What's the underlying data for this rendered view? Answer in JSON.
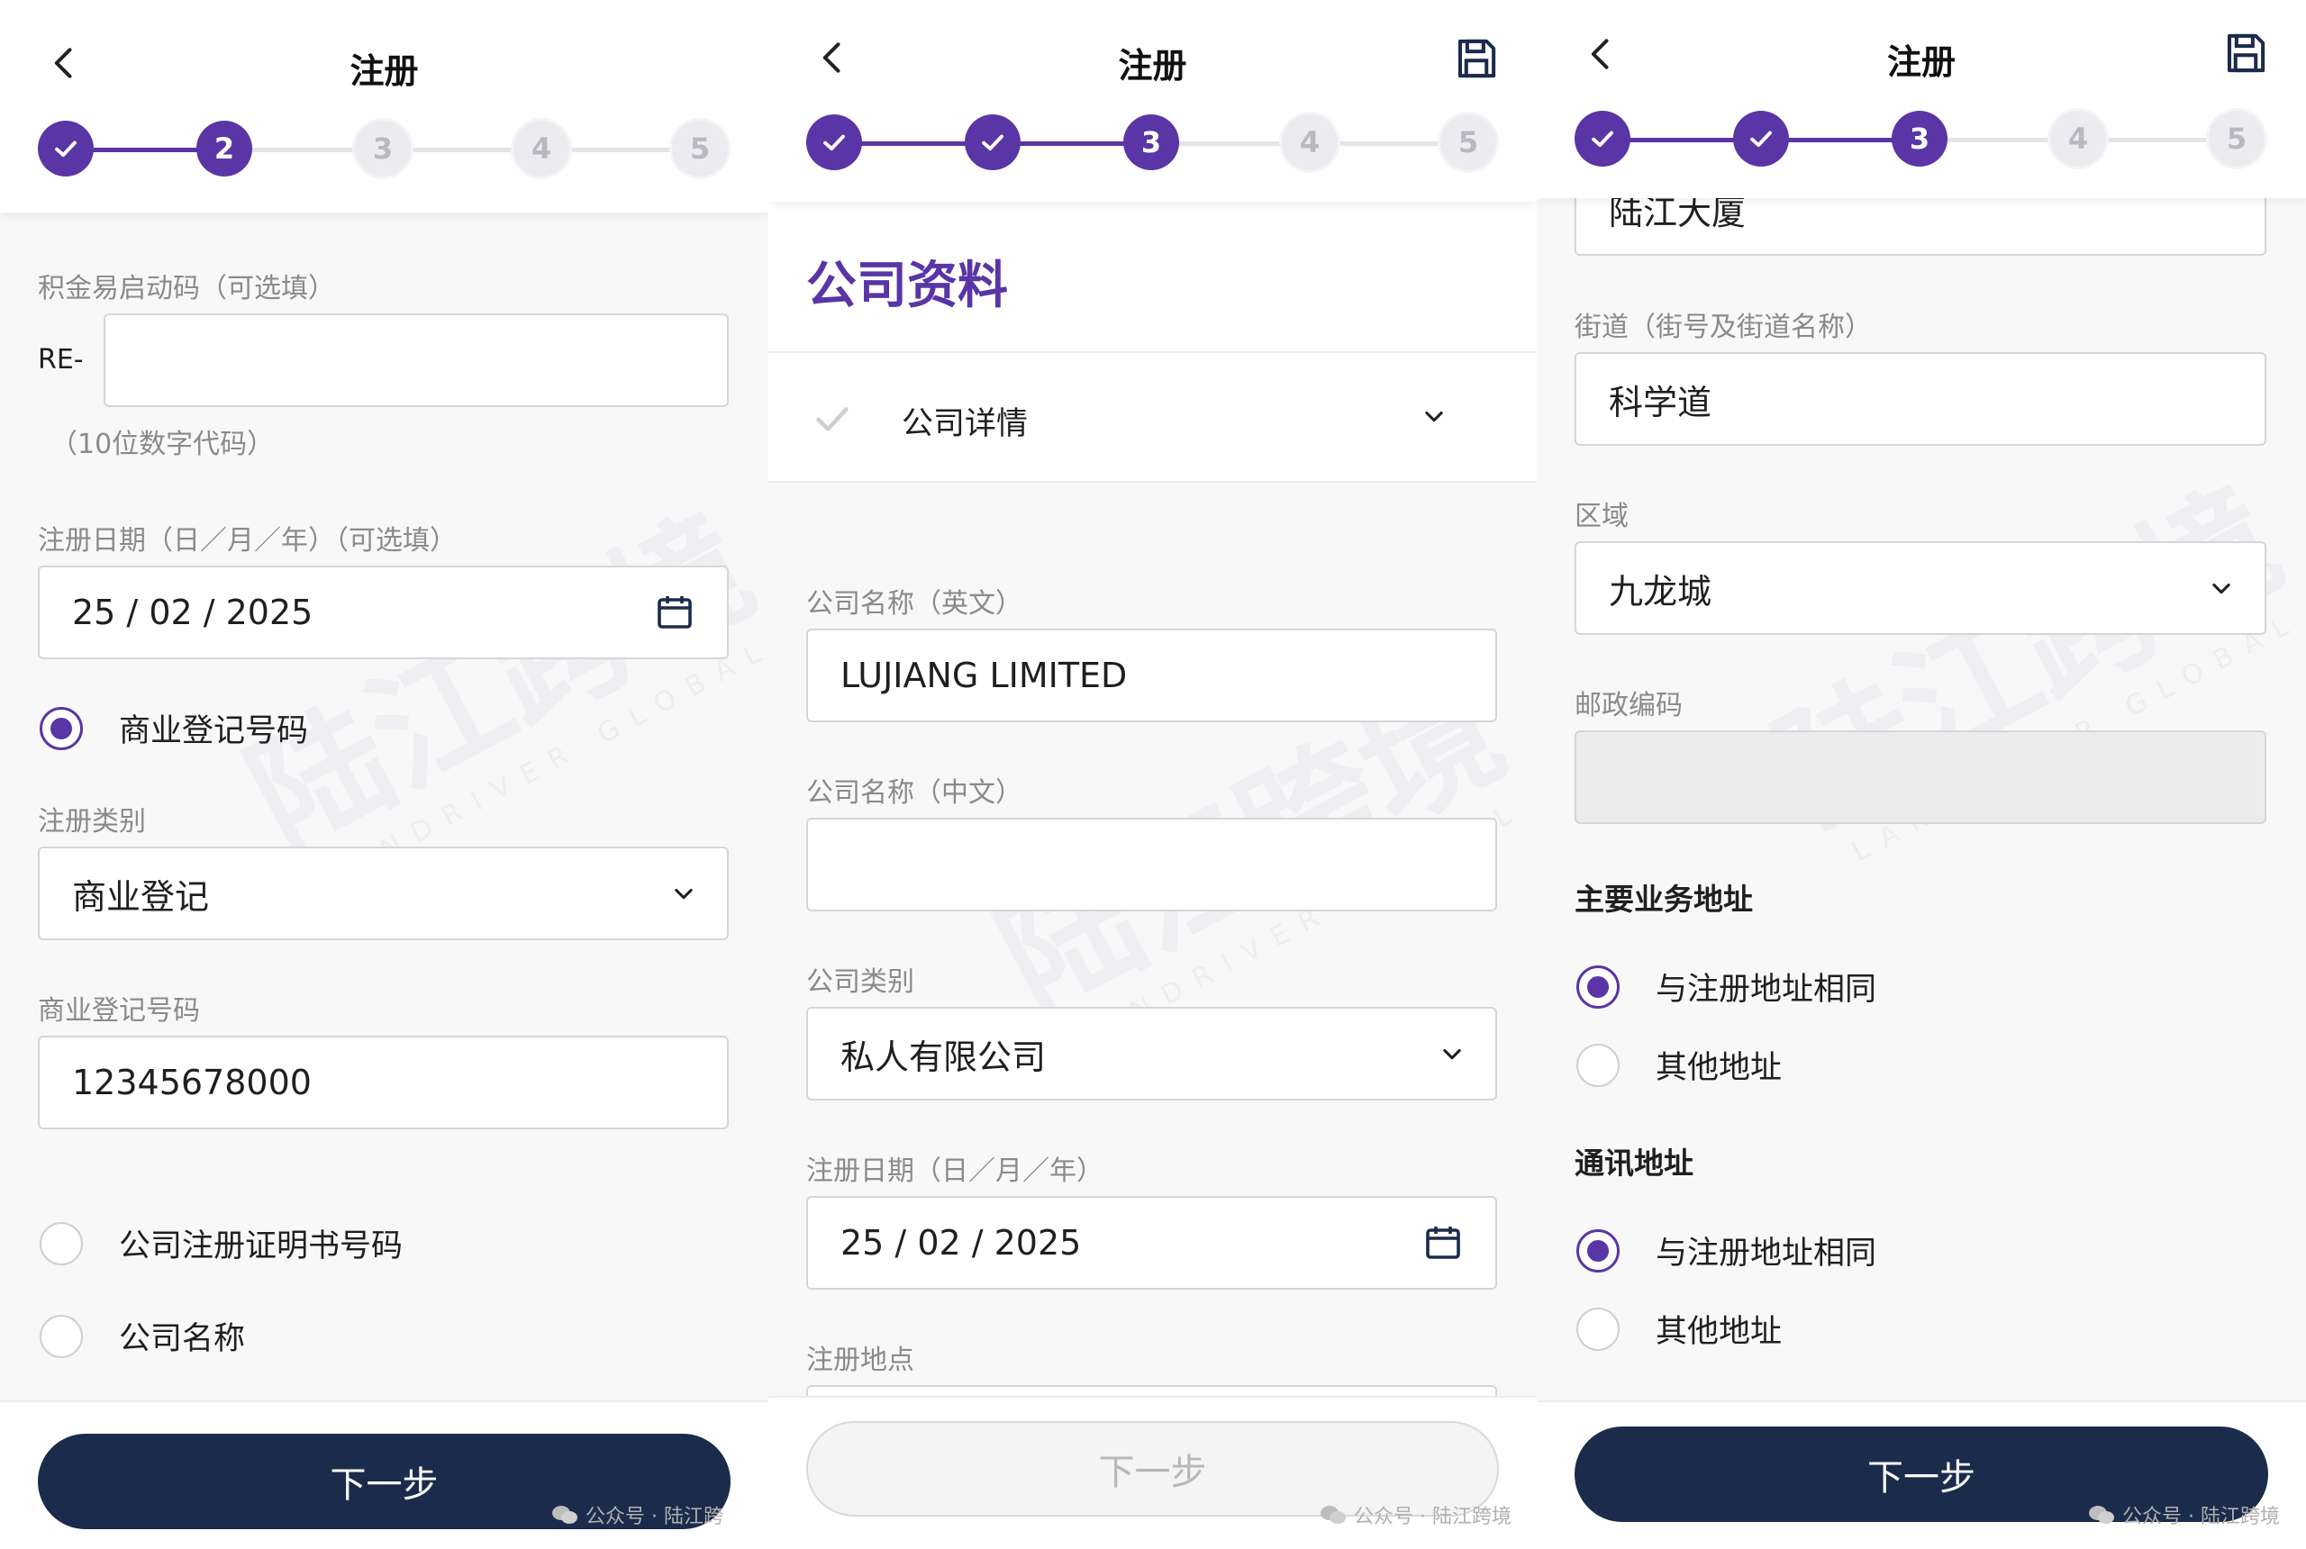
{
  "brand": {
    "accent": "#5a35a6",
    "button_dark": "#1b2b4b",
    "step_inactive": "#ececf0"
  },
  "watermark": {
    "main": "陆江跨境",
    "sub": "LANDRIVER GLOBAL",
    "footer_p1": "公众号 · 陆江跨",
    "footer_p2": "公众号 · 陆江跨境",
    "footer_p3": "公众号 · 陆江跨境"
  },
  "screens": [
    {
      "title": "注册",
      "steps": [
        {
          "label": "✓",
          "state": "done"
        },
        {
          "label": "2",
          "state": "current"
        },
        {
          "label": "3",
          "state": "todo"
        },
        {
          "label": "4",
          "state": "todo"
        },
        {
          "label": "5",
          "state": "todo"
        }
      ],
      "form": {
        "start_code_label": "积金易启动码（可选填）",
        "start_code_prefix": "RE-",
        "start_code_value": "",
        "start_code_hint": "（10位数字代码）",
        "reg_date_label": "注册日期（日／月／年）（可选填）",
        "reg_date_value": "25 / 02 / 2025",
        "radio_br_label": "商业登记号码",
        "reg_type_label": "注册类别",
        "reg_type_value": "商业登记",
        "br_number_label": "商业登记号码",
        "br_number_value": "12345678000",
        "radio_ci_label": "公司注册证明书号码",
        "radio_name_label": "公司名称"
      },
      "next_label": "下一步"
    },
    {
      "title": "注册",
      "steps": [
        {
          "label": "✓",
          "state": "done"
        },
        {
          "label": "✓",
          "state": "done"
        },
        {
          "label": "3",
          "state": "current"
        },
        {
          "label": "4",
          "state": "todo"
        },
        {
          "label": "5",
          "state": "todo"
        }
      ],
      "heading": "公司资料",
      "accordion_label": "公司详情",
      "form": {
        "name_en_label": "公司名称（英文）",
        "name_en_value": "LUJIANG LIMITED",
        "name_zh_label": "公司名称（中文）",
        "name_zh_value": "",
        "company_type_label": "公司类别",
        "company_type_value": "私人有限公司",
        "reg_date_label": "注册日期（日／月／年）",
        "reg_date_value": "25 / 02 / 2025",
        "reg_place_label": "注册地点"
      },
      "next_label": "下一步"
    },
    {
      "title": "注册",
      "steps": [
        {
          "label": "✓",
          "state": "done"
        },
        {
          "label": "✓",
          "state": "done"
        },
        {
          "label": "3",
          "state": "current"
        },
        {
          "label": "4",
          "state": "todo"
        },
        {
          "label": "5",
          "state": "todo"
        }
      ],
      "form": {
        "building_value": "陆江大厦",
        "street_label": "街道（街号及街道名称）",
        "street_value": "科学道",
        "district_label": "区域",
        "district_value": "九龙城",
        "postal_label": "邮政编码",
        "postal_value": ""
      },
      "business_address": {
        "title": "主要业务地址",
        "same_label": "与注册地址相同",
        "other_label": "其他地址"
      },
      "correspondence_address": {
        "title": "通讯地址",
        "same_label": "与注册地址相同",
        "other_label": "其他地址"
      },
      "next_label": "下一步"
    }
  ]
}
